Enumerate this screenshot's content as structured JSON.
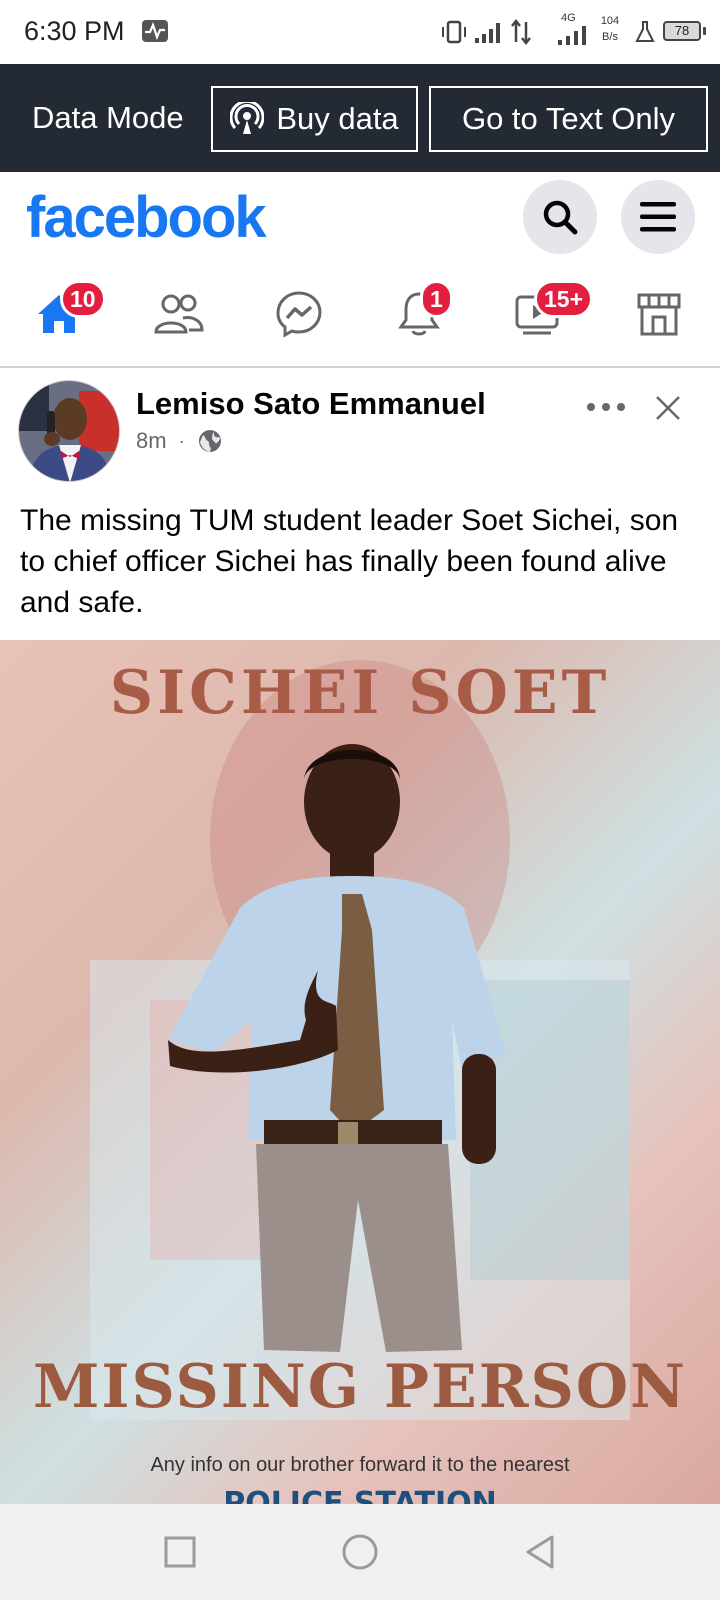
{
  "status_bar": {
    "time": "6:30 PM",
    "network_type": "4G",
    "speed_value": "104",
    "speed_unit": "B/s",
    "battery": "78"
  },
  "data_mode_bar": {
    "label": "Data Mode",
    "buy_data": "Buy data",
    "text_only": "Go to Text Only"
  },
  "header": {
    "logo": "facebook",
    "brand_color": "#1877f2"
  },
  "nav": {
    "home_badge": "10",
    "notifications_badge": "1",
    "watch_badge": "15+",
    "badge_color": "#e41e3f"
  },
  "post": {
    "author": "Lemiso Sato Emmanuel",
    "time": "8m",
    "separator": "·",
    "text": "The missing TUM student leader Soet Sichei, son to chief officer Sichei has finally been found alive and safe.",
    "image": {
      "title": "SICHEI SOET",
      "missing": "MISSING PERSON",
      "info": "Any info on our brother forward it to the nearest",
      "station": "POLICE STATION"
    }
  }
}
